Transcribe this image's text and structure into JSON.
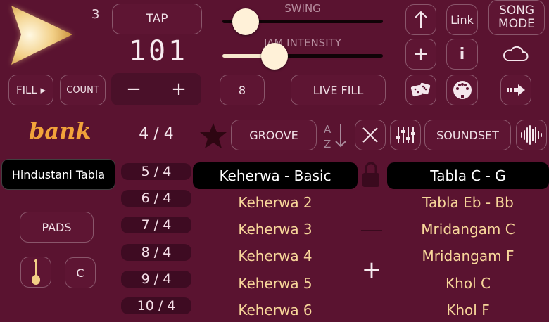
{
  "top": {
    "count_small": "3",
    "tap_label": "TAP",
    "bpm": "101",
    "swing_label": "SWING",
    "swing_level": 0.06,
    "jam_label": "JAM INTENSITY",
    "jam_level": 0.28,
    "link_label": "Link",
    "song_mode_label": "SONG\nMODE",
    "plus_label": "+",
    "info_label": "i"
  },
  "row2": {
    "fill_label": "FILL ▸",
    "count_label": "COUNT",
    "minus_label": "−",
    "plus_label": "+",
    "number_label": "8",
    "live_fill_label": "LIVE FILL"
  },
  "row3": {
    "bank_label": "bank",
    "time_sig_current": "4 / 4",
    "groove_label": "GROOVE",
    "soundset_label": "SOUNDSET"
  },
  "left": {
    "selected_bank": "Hindustani Tabla",
    "pads_label": "PADS",
    "key_label": "C"
  },
  "time_signatures": [
    "5 / 4",
    "6 / 4",
    "7 / 4",
    "8 / 4",
    "9 / 4",
    "10 / 4"
  ],
  "grooves": {
    "selected": "Keherwa - Basic",
    "items": [
      "Keherwa 2",
      "Keherwa 3",
      "Keherwa 4",
      "Keherwa 5",
      "Keherwa 6"
    ]
  },
  "middle": {
    "add_label": "+"
  },
  "soundsets": {
    "selected": "Tabla C - G",
    "items": [
      "Tabla Eb - Bb",
      "Mridangam C",
      "Mridangam F",
      "Khol C",
      "Khol F"
    ]
  },
  "colors": {
    "background": "#5a1330",
    "accent_gold": "#f7d69a",
    "bank_orange": "#f2a33a",
    "selected_bg": "#000000"
  }
}
